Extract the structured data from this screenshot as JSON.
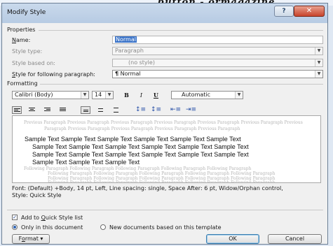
{
  "background": {
    "text": "button - ormagazine"
  },
  "window": {
    "title": "Modify Style",
    "help_label": "?",
    "close_label": "✕"
  },
  "properties": {
    "section_label": "Properties",
    "name": {
      "label": "Name:",
      "value": "Normal"
    },
    "style_type": {
      "label": "Style type:",
      "value": "Paragraph"
    },
    "style_based_on": {
      "label": "Style based on:",
      "value": "(no style)"
    },
    "following": {
      "label": "Style for following paragraph:",
      "value": "Normal",
      "icon": "¶"
    }
  },
  "formatting": {
    "section_label": "Formatting",
    "font": "Calibri (Body)",
    "size": "14",
    "bold": "B",
    "italic": "I",
    "underline": "U",
    "color": "Automatic"
  },
  "preview": {
    "previous_lines": [
      "Previous Paragraph Previous Paragraph Previous Paragraph Previous Paragraph Previous Paragraph Previous Paragraph Previous",
      "Paragraph Previous Paragraph Previous Paragraph Previous Paragraph Previous Paragraph"
    ],
    "sample_lines": [
      "Sample Text Sample Text Sample Text Sample Text Sample Text Sample Text",
      "Sample Text Sample Text Sample Text Sample Text Sample Text Sample Text",
      "Sample Text Sample Text Sample Text Sample Text Sample Text Sample Text",
      "Sample Text Sample Text Sample Text"
    ],
    "following_lines": [
      "Following Paragraph Following Paragraph Following Paragraph Following Paragraph Following Paragraph",
      "Following Paragraph Following Paragraph Following Paragraph Following Paragraph Following Paragraph",
      "Following Paragraph Following Paragraph Following Paragraph Following Paragraph Following Paragraph",
      "Following Paragraph Following Paragraph Following Paragraph Following Paragraph Following Paragraph"
    ]
  },
  "description": {
    "line1": "Font: (Default) +Body, 14 pt, Left, Line spacing:  single, Space After:  6 pt, Widow/Orphan control,",
    "line2": "Style: Quick Style"
  },
  "options": {
    "add_quick_style": {
      "label": "Add to Quick Style list",
      "checked": true
    },
    "only_this_document": {
      "label": "Only in this document",
      "selected": true
    },
    "new_documents": {
      "label": "New documents based on this template",
      "selected": false
    }
  },
  "buttons": {
    "format": "Format",
    "ok": "OK",
    "cancel": "Cancel"
  },
  "colors": {
    "accent": "#3a73c8",
    "title_bar": "#c9d9ec",
    "close": "#c7432b"
  }
}
